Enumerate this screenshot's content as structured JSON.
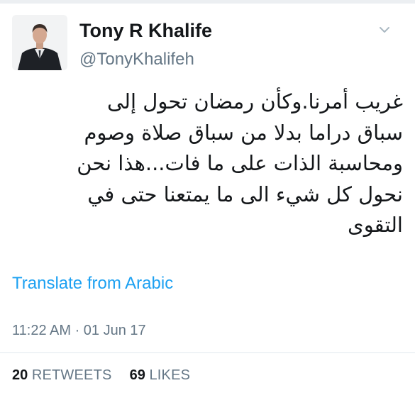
{
  "tweet": {
    "author": {
      "display_name": "Tony R Khalife",
      "screen_name": "@TonyKhalifeh"
    },
    "text_lines": [
      "غريب أمرنا.وكأن رمضان تحول إلى",
      "سباق دراما بدلا من سباق صلاة وصوم",
      "ومحاسبة الذات على ما فات...هذا نحن",
      "نحول كل شيء الى ما يمتعنا حتى في",
      "التقوى"
    ],
    "translate_label": "Translate from Arabic",
    "timestamp": "11:22 AM · 01 Jun 17",
    "stats": {
      "retweets_count": "20",
      "retweets_label": "RETWEETS",
      "likes_count": "69",
      "likes_label": "LIKES"
    }
  },
  "icons": {
    "menu": "chevron-down-icon"
  },
  "colors": {
    "link": "#1da1f2",
    "secondary_text": "#657786",
    "primary_text": "#14171a"
  }
}
